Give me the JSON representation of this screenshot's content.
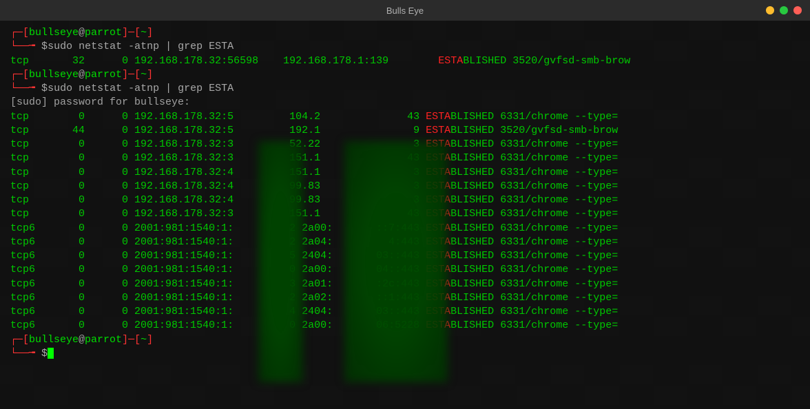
{
  "window": {
    "title": "Bulls Eye"
  },
  "prompt": {
    "bracket_open": "┌─[",
    "user": "bullseye",
    "at": "@",
    "host": "parrot",
    "bracket_mid": "]─[",
    "path": "~",
    "bracket_close": "]",
    "line2_prefix": "└──╼ ",
    "dollar": "$"
  },
  "cmd1": "sudo netstat -atnp | grep ESTA",
  "out1": {
    "proto": "tcp",
    "recv": "32",
    "send": "0",
    "local": "192.168.178.32:56598",
    "foreign": "192.168.178.1:139",
    "state_head": "ESTA",
    "state_tail": "BLISHED",
    "pidprog": "3520/gvfsd-smb-brow"
  },
  "cmd2": "sudo netstat -atnp | grep ESTA",
  "sudo_prompt": "[sudo] password for bullseye:",
  "rows": [
    {
      "proto": "tcp",
      "recv": "0",
      "send": "0",
      "local": "192.168.178.32:5",
      "foreign_a": "104.2",
      "foreign_b": "43",
      "pidprog": "6331/chrome --type="
    },
    {
      "proto": "tcp",
      "recv": "44",
      "send": "0",
      "local": "192.168.178.32:5",
      "foreign_a": "192.1",
      "foreign_b": "9",
      "pidprog": "3520/gvfsd-smb-brow"
    },
    {
      "proto": "tcp",
      "recv": "0",
      "send": "0",
      "local": "192.168.178.32:3",
      "foreign_a": "52.22",
      "foreign_b": "3",
      "pidprog": "6331/chrome --type="
    },
    {
      "proto": "tcp",
      "recv": "0",
      "send": "0",
      "local": "192.168.178.32:3",
      "foreign_a": "151.1",
      "foreign_b": "43",
      "pidprog": "6331/chrome --type="
    },
    {
      "proto": "tcp",
      "recv": "0",
      "send": "0",
      "local": "192.168.178.32:4",
      "foreign_a": "151.1",
      "foreign_b": "3",
      "pidprog": "6331/chrome --type="
    },
    {
      "proto": "tcp",
      "recv": "0",
      "send": "0",
      "local": "192.168.178.32:4",
      "foreign_a": "99.83",
      "foreign_b": "3",
      "pidprog": "6331/chrome --type="
    },
    {
      "proto": "tcp",
      "recv": "0",
      "send": "0",
      "local": "192.168.178.32:4",
      "foreign_a": "99.83",
      "foreign_b": "3",
      "pidprog": "6331/chrome --type="
    },
    {
      "proto": "tcp",
      "recv": "0",
      "send": "0",
      "local": "192.168.178.32:3",
      "foreign_a": "151.1",
      "foreign_b": "43",
      "pidprog": "6331/chrome --type="
    },
    {
      "proto": "tcp6",
      "recv": "0",
      "send": "0",
      "local": "2001:981:1540:1:",
      "foreign_a": "2 2a00:",
      "foreign_b": "::7:443",
      "pidprog": "6331/chrome --type="
    },
    {
      "proto": "tcp6",
      "recv": "0",
      "send": "0",
      "local": "2001:981:1540:1:",
      "foreign_a": "2 2a04:",
      "foreign_b": "4:443",
      "pidprog": "6331/chrome --type="
    },
    {
      "proto": "tcp6",
      "recv": "0",
      "send": "0",
      "local": "2001:981:1540:1:",
      "foreign_a": "5 2404:",
      "foreign_b": "03::443",
      "pidprog": "6331/chrome --type="
    },
    {
      "proto": "tcp6",
      "recv": "0",
      "send": "0",
      "local": "2001:981:1540:1:",
      "foreign_a": "0 2a00:",
      "foreign_b": "04::443",
      "pidprog": "6331/chrome --type="
    },
    {
      "proto": "tcp6",
      "recv": "0",
      "send": "0",
      "local": "2001:981:1540:1:",
      "foreign_a": "3 2a01:",
      "foreign_b": ":2c:443",
      "pidprog": "6331/chrome --type="
    },
    {
      "proto": "tcp6",
      "recv": "0",
      "send": "0",
      "local": "2001:981:1540:1:",
      "foreign_a": "2 2a02:",
      "foreign_b": "::1:443",
      "pidprog": "6331/chrome --type="
    },
    {
      "proto": "tcp6",
      "recv": "0",
      "send": "0",
      "local": "2001:981:1540:1:",
      "foreign_a": "4 2404:",
      "foreign_b": "03::443",
      "pidprog": "6331/chrome --type="
    },
    {
      "proto": "tcp6",
      "recv": "0",
      "send": "0",
      "local": "2001:981:1540:1:",
      "foreign_a": "0 2a00:",
      "foreign_b": "06:5228",
      "pidprog": "6331/chrome --type="
    }
  ],
  "state_head": "ESTA",
  "state_tail": "BLISHED"
}
